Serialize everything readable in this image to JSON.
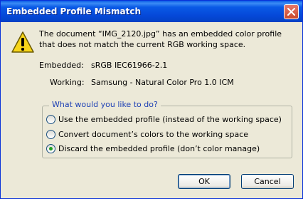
{
  "dialog": {
    "title": "Embedded Profile Mismatch",
    "message_line1": "The document “IMG_2120.jpg” has an embedded color profile",
    "message_line2": "that does not match the current RGB working space.",
    "embedded_label": "Embedded:",
    "embedded_value": "sRGB IEC61966-2.1",
    "working_label": "Working:",
    "working_value": "Samsung - Natural Color Pro 1.0 ICM",
    "question": "What would you like to do?",
    "options": [
      {
        "label": "Use the embedded profile (instead of the working space)",
        "selected": false
      },
      {
        "label": "Convert document’s colors to the working space",
        "selected": false
      },
      {
        "label": "Discard the embedded profile (don’t color manage)",
        "selected": true
      }
    ],
    "ok_label": "OK",
    "cancel_label": "Cancel"
  },
  "icons": {
    "warning": "warning-icon",
    "close": "close-icon"
  },
  "colors": {
    "titlebar": "#0a5ae6",
    "legend": "#1c3fb4",
    "background": "#ece9d8"
  }
}
